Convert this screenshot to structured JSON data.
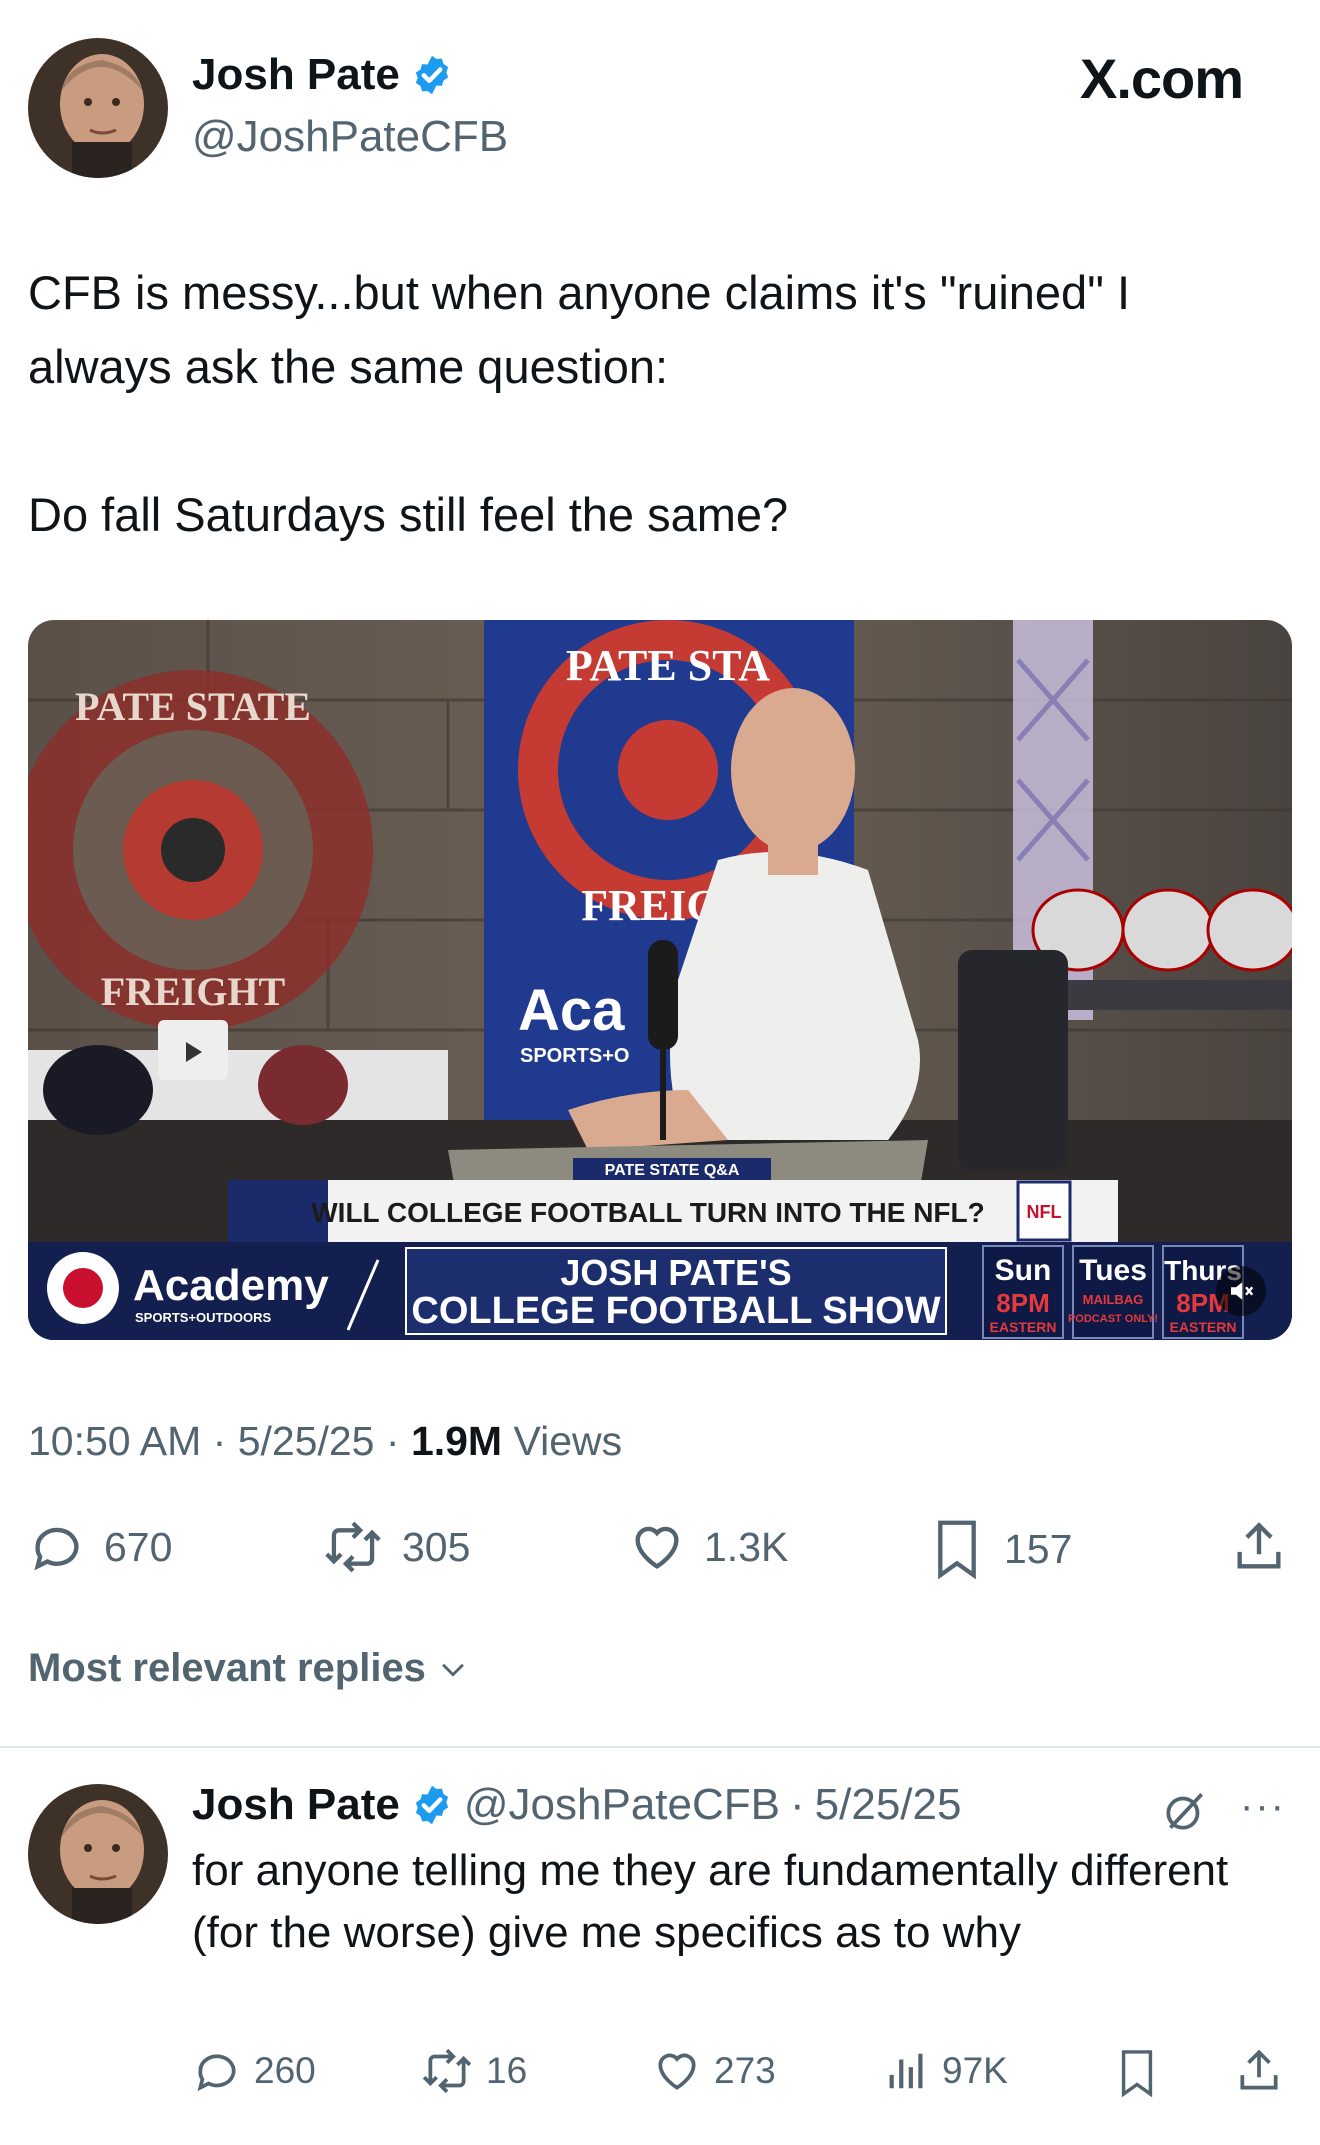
{
  "tweet": {
    "author_name": "Josh Pate",
    "author_handle": "@JoshPateCFB",
    "brand": "X.com",
    "text": "CFB is messy...but when anyone claims it's \"ruined\" I\nalways ask the same question:\n\nDo fall Saturdays still feel the same?",
    "time": "10:50 AM",
    "date": "5/25/25",
    "views_count": "1.9M",
    "views_label": "Views",
    "stats": {
      "replies": "670",
      "reposts": "305",
      "likes": "1.3K",
      "bookmarks": "157"
    }
  },
  "video": {
    "wall_logo_top": "PATE STATE",
    "wall_logo_bottom": "FREIGHT",
    "banner_logo_top": "PATE STA",
    "banner_logo_bottom": "FREIGH",
    "banner_sponsor": "Aca",
    "banner_sponsor_sub": "SPORTS+O",
    "segment_tag": "PATE STATE Q&A",
    "headline": "WILL COLLEGE FOOTBALL TURN INTO THE NFL?",
    "nfl_badge": "NFL",
    "sponsor": "Academy",
    "sponsor_sub": "SPORTS+OUTDOORS",
    "show_line1": "JOSH PATE'S",
    "show_line2": "COLLEGE FOOTBALL SHOW",
    "schedule": [
      {
        "day": "Sun",
        "time": "8PM",
        "note": "EASTERN"
      },
      {
        "day": "Tues",
        "time": "MAILBAG",
        "note": "PODCAST ONLY!"
      },
      {
        "day": "Thurs",
        "time": "8PM",
        "note": "EASTERN"
      }
    ]
  },
  "replies_header": "Most relevant replies",
  "reply": {
    "author_name": "Josh Pate",
    "author_handle": "@JoshPateCFB",
    "date": "5/25/25",
    "text": "for anyone telling me they are fundamentally different (for the worse) give me specifics as to why",
    "stats": {
      "replies": "260",
      "reposts": "16",
      "likes": "273",
      "views": "97K"
    }
  },
  "colors": {
    "verified": "#1d9bf0",
    "muted": "#536471",
    "text": "#0f1419",
    "nav_blue": "#1b2a6b"
  }
}
